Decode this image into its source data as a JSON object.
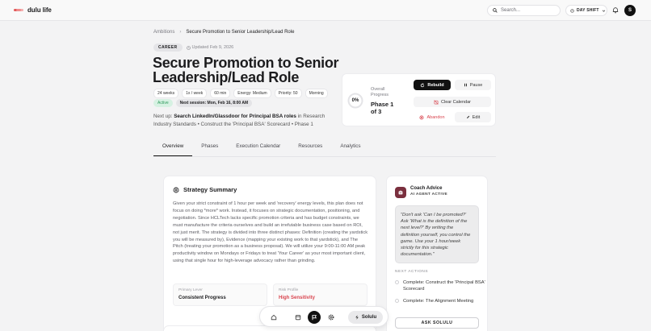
{
  "app": {
    "name": "dulu life"
  },
  "topbar": {
    "search_placeholder": "Search...",
    "shift_label": "DAY SHIFT",
    "avatar_initial": "S"
  },
  "breadcrumb": {
    "parent": "Ambitions",
    "separator": "›",
    "current": "Secure Promotion to Senior Leadership/Lead Role"
  },
  "goal": {
    "category": "CAREER",
    "updated": "Updated Feb 9, 2026",
    "title": "Secure Promotion to Senior Leadership/Lead Role",
    "pills": [
      "24 weeks",
      "1x / week",
      "60 min",
      "Energy: Medium",
      "Priority: 50",
      "Morning"
    ],
    "status": "Active",
    "next_session": "Next session: Mon, Feb 16, 8:00 AM",
    "next_up_label": "Next up:",
    "next_up_task": "Search LinkedIn/Glassdoor for Principal BSA roles",
    "next_up_rest": "in Research Industry Standards • Construct the 'Principal BSA' Scorecard • Phase 1"
  },
  "progress": {
    "percent_text": "0%",
    "percent": 0,
    "label": "Overall Progress",
    "phase": "Phase 1 of 3",
    "buttons": {
      "rebuild": "Rebuild",
      "pause": "Pause",
      "clear_calendar": "Clear Calendar",
      "abandon": "Abandon",
      "edit": "Edit"
    }
  },
  "tabs": [
    "Overview",
    "Phases",
    "Execution Calendar",
    "Resources",
    "Analytics"
  ],
  "strategy": {
    "title": "Strategy Summary",
    "body": "Given your strict constraint of 1 hour per week and 'recovery' energy levels, this plan does not focus on doing *more* work. Instead, it focuses on strategic documentation, positioning, and negotiation. Since HCLTech lacks specific promotion criteria and has budget constraints, we must manufacture the criteria ourselves and build an irrefutable business case based on ROI, not just merit. The strategy is divided into three distinct phases: Definition (creating the yardstick you will be measured by), Evidence (mapping your existing work to that yardstick), and The Pitch (treating your promotion as a business proposal). We will utilize your 9:00-11:00 AM peak productivity window on Mondays or Fridays to treat 'Your Career' as your most important client, using that single hour for high-leverage advocacy rather than grinding.",
    "primary_lever_label": "Primary Lever",
    "primary_lever_value": "Consistent Progress",
    "risk_label": "Risk Profile",
    "risk_value": "High Sensitivity"
  },
  "coach": {
    "name": "Coach Advice",
    "status": "AI AGENT ACTIVE",
    "quote": "\"Don't ask 'Can I be promoted?' Ask 'What is the definition of the next level?' By writing the definition yourself, you control the game. Use your 1 hour/week strictly for this strategic documentation.\"",
    "next_actions_label": "NEXT ACTIONS",
    "next_actions": [
      "Complete: Construct the 'Principal BSA' Scorecard",
      "Complete: The Alignment Meeting"
    ],
    "ask_button": "ASK SOLULU"
  },
  "dock": {
    "solulu_label": "Solulu"
  },
  "colors": {
    "accent": "#111111",
    "active_green": "#2e9a5c",
    "risk_red": "#d9454f",
    "coach_icon": "#7a2f3e"
  }
}
